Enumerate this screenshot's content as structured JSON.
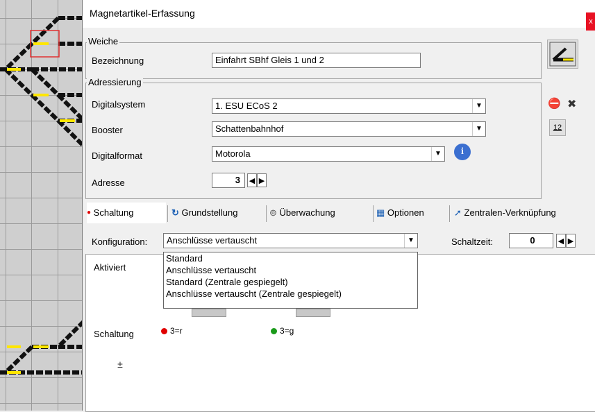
{
  "window": {
    "title": "Magnetartikel-Erfassung",
    "close_label": "x"
  },
  "weiche": {
    "group_label": "Weiche",
    "bezeichnung_label": "Bezeichnung",
    "bezeichnung_value": "Einfahrt SBhf Gleis 1 und 2"
  },
  "adressierung": {
    "group_label": "Adressierung",
    "digitalsystem_label": "Digitalsystem",
    "digitalsystem_value": "1. ESU ECoS 2",
    "booster_label": "Booster",
    "booster_value": "Schattenbahnhof",
    "digitalformat_label": "Digitalformat",
    "digitalformat_value": "Motorola",
    "adresse_label": "Adresse",
    "adresse_value": "3",
    "address_button_label": "12"
  },
  "tabs": [
    {
      "label": "Schaltung",
      "icon": "schaltung-icon"
    },
    {
      "label": "Grundstellung",
      "icon": "grundstellung-icon"
    },
    {
      "label": "Überwachung",
      "icon": "binoculars-icon"
    },
    {
      "label": "Optionen",
      "icon": "options-icon"
    },
    {
      "label": "Zentralen-Verknüpfung",
      "icon": "arrow-icon"
    }
  ],
  "schaltung": {
    "konfiguration_label": "Konfiguration:",
    "konfiguration_value": "Anschlüsse vertauscht",
    "schaltzeit_label": "Schaltzeit:",
    "schaltzeit_value": "0",
    "dropdown_options": [
      "Standard",
      "Anschlüsse vertauscht",
      "Standard (Zentrale gespiegelt)",
      "Anschlüsse vertauscht (Zentrale gespiegelt)"
    ],
    "aktiviert_label": "Aktiviert",
    "schaltung_label": "Schaltung",
    "red_state": "3=r",
    "green_state": "3=g"
  },
  "colors": {
    "red": "#e00000",
    "green": "#1a9a1a",
    "track_yellow": "#ffe600",
    "close_red": "#e81123"
  }
}
